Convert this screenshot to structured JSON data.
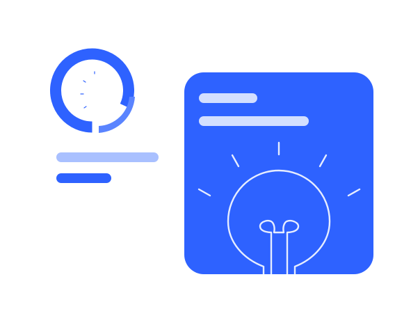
{
  "colors": {
    "background": "#ffffff",
    "primary_blue": "#2e62ff",
    "medium_blue": "#5a84ff",
    "light_blue": "#a9c0ff",
    "pale_blue": "#d3dfff",
    "outline": "#e6edff"
  },
  "icons": {
    "gauge": "gauge-icon",
    "lightbulb": "lightbulb-icon"
  },
  "gauge": {
    "fill_fraction": 0.82
  }
}
